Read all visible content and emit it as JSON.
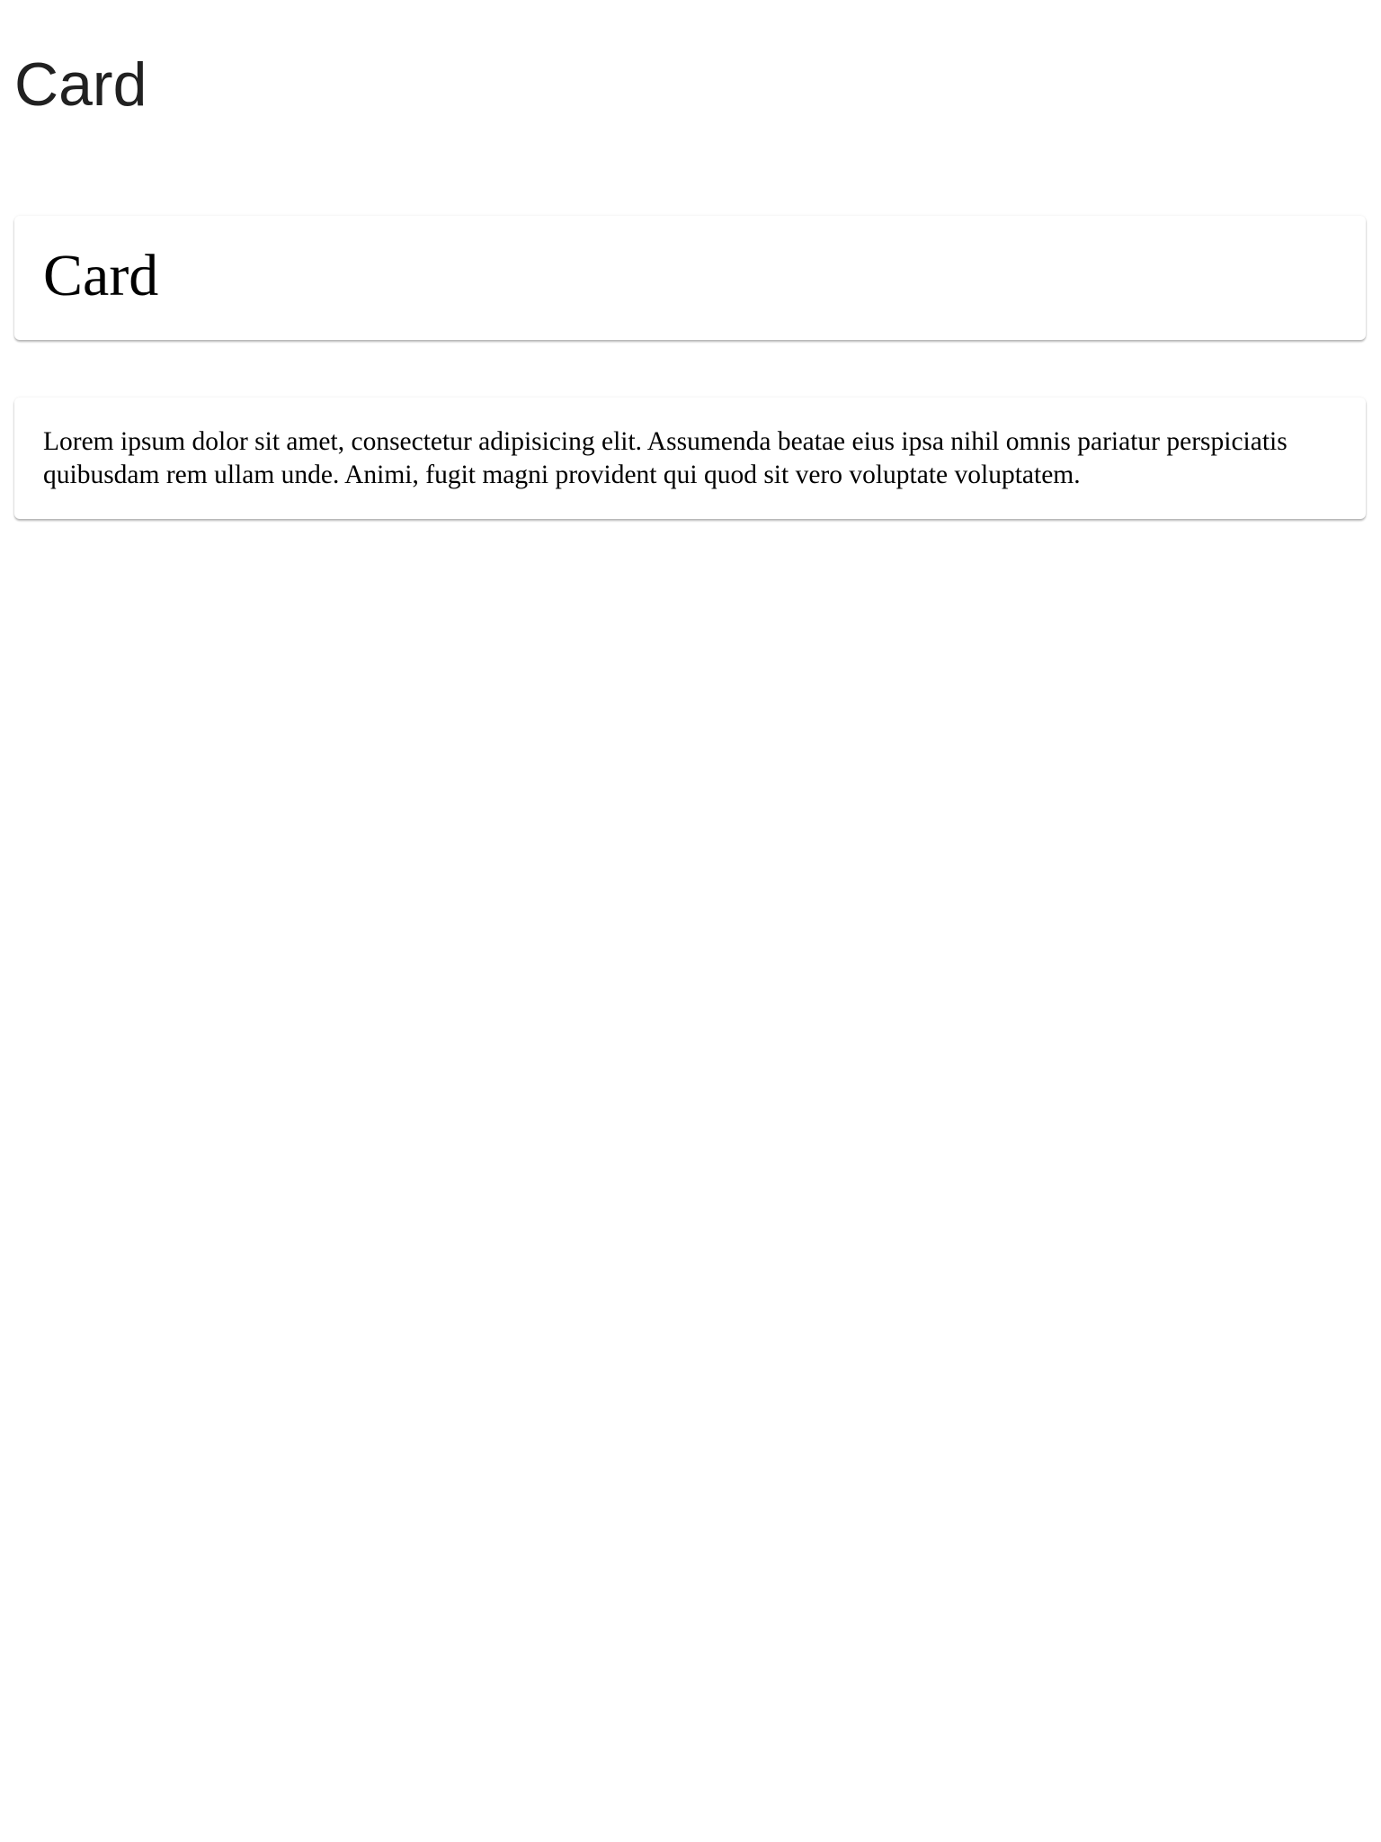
{
  "page": {
    "heading": "Card"
  },
  "cards": [
    {
      "title": "Card"
    },
    {
      "text": "Lorem ipsum dolor sit amet, consectetur adipisicing elit. Assumenda beatae eius ipsa nihil omnis pariatur perspiciatis quibusdam rem ullam unde. Animi, fugit magni provident qui quod sit vero voluptate voluptatem."
    }
  ],
  "colors": {
    "background": "#ffffff",
    "heading_text": "#212121",
    "card_text": "#000000",
    "card_background": "#ffffff"
  }
}
